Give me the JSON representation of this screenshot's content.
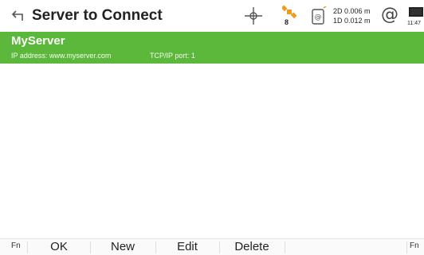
{
  "header": {
    "title": "Server to Connect",
    "satellite_count": "8",
    "precision_2d": "2D 0.006 m",
    "precision_1d": "1D 0.012 m",
    "time": "11:47"
  },
  "server": {
    "name": "MyServer",
    "ip": "IP address: www.myserver.com",
    "port": "TCP/IP port: 1"
  },
  "softkeys": {
    "fn_left": "Fn",
    "ok": "OK",
    "new": "New",
    "edit": "Edit",
    "delete": "Delete",
    "fn_right": "Fn"
  },
  "colors": {
    "accent": "#5cb83a",
    "satellite": "#f29a1d"
  }
}
